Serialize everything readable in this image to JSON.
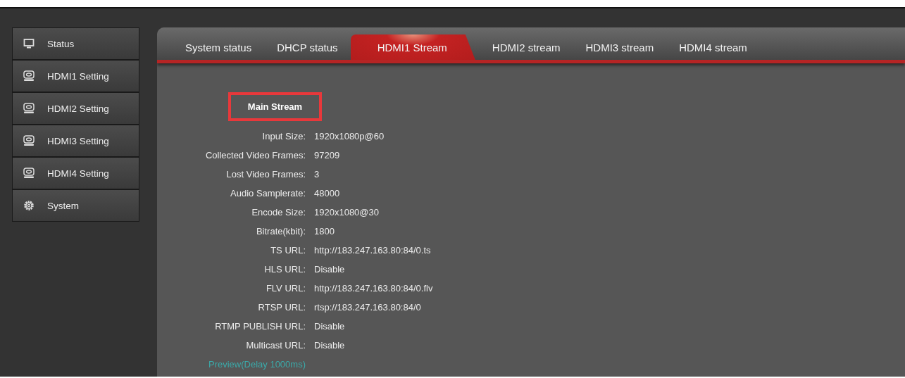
{
  "sidebar": {
    "items": [
      {
        "label": "Status",
        "kind": "monitor"
      },
      {
        "label": "HDMI1 Setting",
        "kind": "hdmi"
      },
      {
        "label": "HDMI2 Setting",
        "kind": "hdmi"
      },
      {
        "label": "HDMI3 Setting",
        "kind": "hdmi"
      },
      {
        "label": "HDMI4 Setting",
        "kind": "hdmi"
      },
      {
        "label": "System",
        "kind": "gear"
      }
    ]
  },
  "tabs": [
    {
      "label": "System status",
      "selected": false
    },
    {
      "label": "DHCP status",
      "selected": false
    },
    {
      "label": "HDMI1 Stream",
      "selected": true
    },
    {
      "label": "HDMI2 stream",
      "selected": false
    },
    {
      "label": "HDMI3 stream",
      "selected": false
    },
    {
      "label": "HDMI4 stream",
      "selected": false
    }
  ],
  "stream": {
    "title": "Main Stream",
    "fields": [
      {
        "label": "Input Size:",
        "value": "1920x1080p@60"
      },
      {
        "label": "Collected Video Frames:",
        "value": "97209"
      },
      {
        "label": "Lost Video Frames:",
        "value": "3"
      },
      {
        "label": "Audio Samplerate:",
        "value": "48000"
      },
      {
        "label": "Encode Size:",
        "value": "1920x1080@30"
      },
      {
        "label": "Bitrate(kbit):",
        "value": "1800"
      },
      {
        "label": "TS URL:",
        "value": "http://183.247.163.80:84/0.ts"
      },
      {
        "label": "HLS URL:",
        "value": "Disable"
      },
      {
        "label": "FLV URL:",
        "value": "http://183.247.163.80:84/0.flv"
      },
      {
        "label": "RTSP URL:",
        "value": "rtsp://183.247.163.80:84/0"
      },
      {
        "label": "RTMP PUBLISH URL:",
        "value": "Disable"
      },
      {
        "label": "Multicast URL:",
        "value": "Disable"
      }
    ],
    "preview_link": "Preview(Delay 1000ms)"
  }
}
